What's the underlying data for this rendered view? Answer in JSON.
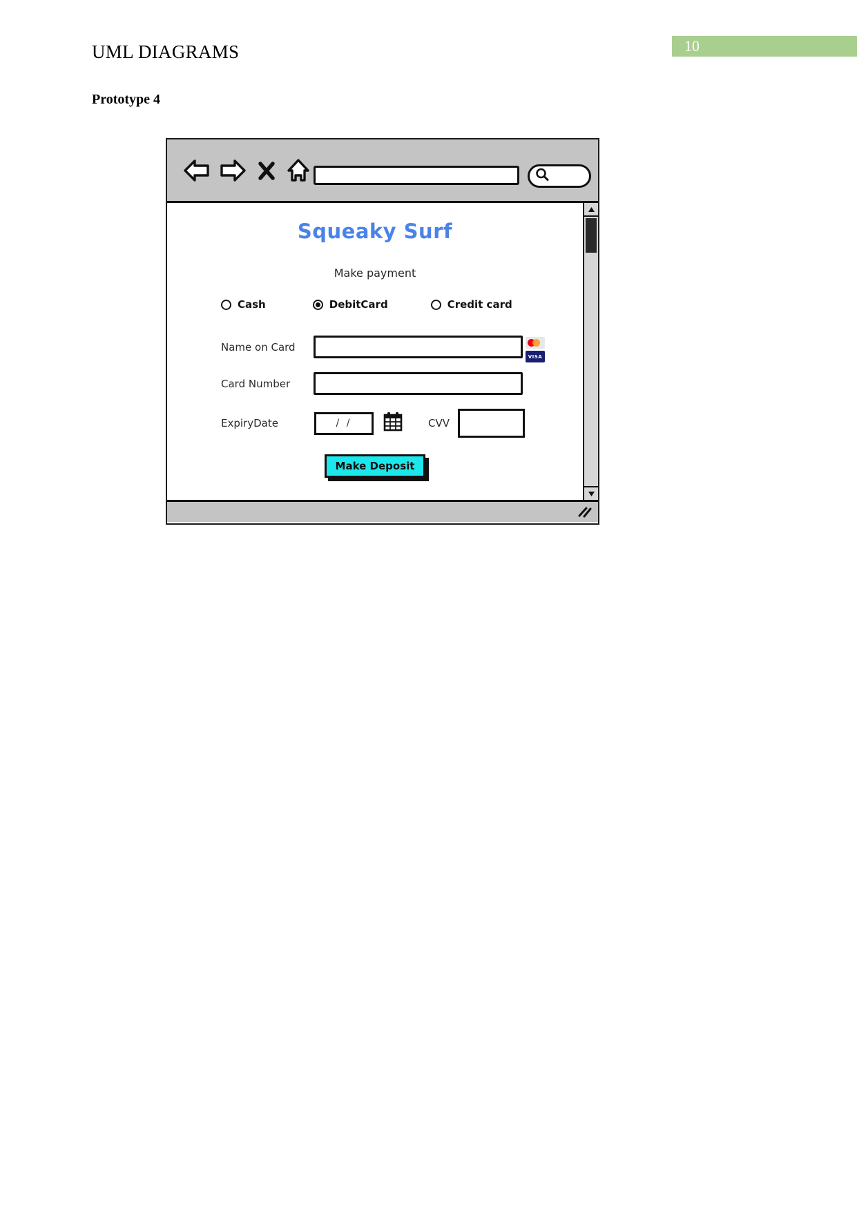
{
  "document": {
    "title": "UML DIAGRAMS",
    "page_number": "10",
    "section_title": "Prototype 4",
    "page_badge_color": "#a9cf8f"
  },
  "browser": {
    "toolbar": {
      "back_icon": "back-arrow-icon",
      "forward_icon": "forward-arrow-icon",
      "stop_icon": "close-x-icon",
      "home_icon": "home-icon",
      "url_value": "",
      "url_placeholder": "",
      "search_icon": "magnifier-icon",
      "search_value": ""
    },
    "scrollbar": {
      "up_icon": "triangle-up-icon",
      "down_icon": "triangle-down-icon"
    },
    "statusbar": {
      "resize_grip_icon": "resize-grip-icon"
    }
  },
  "app": {
    "brand": "Squeaky Surf",
    "brand_color": "#4a83e8",
    "subtitle": "Make payment",
    "payment_methods": [
      {
        "label": "Cash",
        "selected": false
      },
      {
        "label": "DebitCard",
        "selected": true
      },
      {
        "label": "Credit card",
        "selected": false
      }
    ],
    "fields": {
      "name_on_card": {
        "label": "Name on Card",
        "value": "",
        "placeholder": ""
      },
      "card_number": {
        "label": "Card Number",
        "value": "",
        "placeholder": ""
      },
      "expiry_date": {
        "label": "ExpiryDate",
        "value": "/ /",
        "placeholder": "/ /"
      },
      "cvv": {
        "label": "CVV",
        "value": "",
        "placeholder": ""
      }
    },
    "calendar_icon": "calendar-icon",
    "card_logos": [
      {
        "name": "mastercard-logo",
        "text": ""
      },
      {
        "name": "visa-logo",
        "text": "VISA"
      }
    ],
    "submit_button": {
      "label": "Make Deposit",
      "color": "#1ce8ec"
    }
  }
}
